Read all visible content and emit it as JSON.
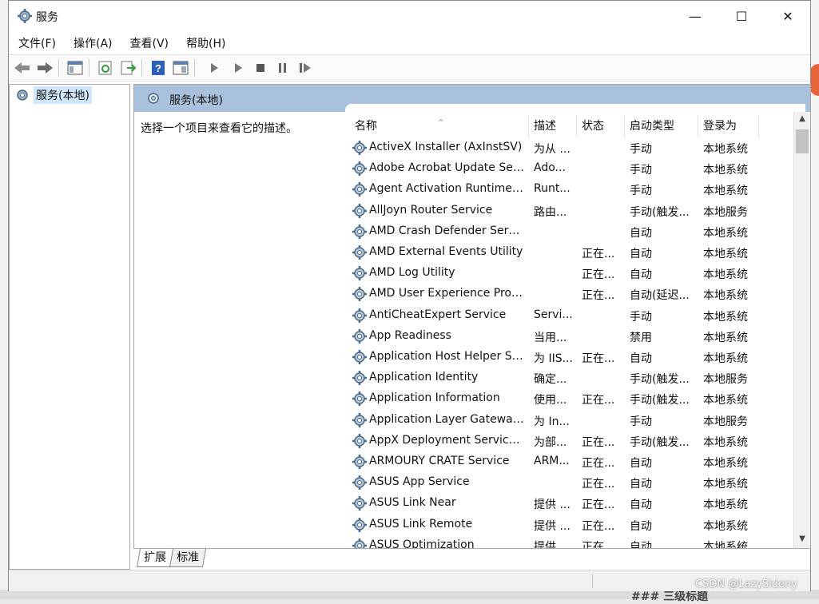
{
  "window": {
    "title": "服务",
    "controls": {
      "minimize": "—",
      "maximize": "☐",
      "close": "✕"
    }
  },
  "menu": [
    "文件(F)",
    "操作(A)",
    "查看(V)",
    "帮助(H)"
  ],
  "toolbar": {
    "icons": [
      "back-arrow-icon",
      "forward-arrow-icon",
      "show-hide-tree-icon",
      "refresh-icon",
      "export-list-icon",
      "help-icon",
      "properties-icon",
      "start-service-icon",
      "start-service-alt-icon",
      "stop-service-icon",
      "pause-service-icon",
      "restart-service-icon"
    ]
  },
  "tree": {
    "root_label": "服务(本地)"
  },
  "pane": {
    "header": "服务(本地)",
    "description": "选择一个项目来查看它的描述。"
  },
  "columns": [
    "名称",
    "描述",
    "状态",
    "启动类型",
    "登录为"
  ],
  "services": [
    {
      "name": "ActiveX Installer (AxInstSV)",
      "desc": "为从 ...",
      "status": "",
      "startup": "手动",
      "logon": "本地系统"
    },
    {
      "name": "Adobe Acrobat Update Ser...",
      "desc": "Ado...",
      "status": "",
      "startup": "手动",
      "logon": "本地系统"
    },
    {
      "name": "Agent Activation Runtime_...",
      "desc": "Runt...",
      "status": "",
      "startup": "手动",
      "logon": "本地系统"
    },
    {
      "name": "AllJoyn Router Service",
      "desc": "路由...",
      "status": "",
      "startup": "手动(触发...",
      "logon": "本地服务"
    },
    {
      "name": "AMD Crash Defender Servi...",
      "desc": "",
      "status": "",
      "startup": "自动",
      "logon": "本地系统"
    },
    {
      "name": "AMD External Events Utility",
      "desc": "",
      "status": "正在...",
      "startup": "自动",
      "logon": "本地系统"
    },
    {
      "name": "AMD Log Utility",
      "desc": "",
      "status": "正在...",
      "startup": "自动",
      "logon": "本地系统"
    },
    {
      "name": "AMD User Experience Prog...",
      "desc": "",
      "status": "正在...",
      "startup": "自动(延迟...",
      "logon": "本地系统"
    },
    {
      "name": "AntiCheatExpert Service",
      "desc": "Servi...",
      "status": "",
      "startup": "手动",
      "logon": "本地系统"
    },
    {
      "name": "App Readiness",
      "desc": "当用...",
      "status": "",
      "startup": "禁用",
      "logon": "本地系统"
    },
    {
      "name": "Application Host Helper Se...",
      "desc": "为 IIS...",
      "status": "正在...",
      "startup": "自动",
      "logon": "本地系统"
    },
    {
      "name": "Application Identity",
      "desc": "确定...",
      "status": "",
      "startup": "手动(触发...",
      "logon": "本地服务"
    },
    {
      "name": "Application Information",
      "desc": "使用...",
      "status": "正在...",
      "startup": "手动(触发...",
      "logon": "本地系统"
    },
    {
      "name": "Application Layer Gateway ...",
      "desc": "为 In...",
      "status": "",
      "startup": "手动",
      "logon": "本地服务"
    },
    {
      "name": "AppX Deployment Service ...",
      "desc": "为部...",
      "status": "正在...",
      "startup": "手动(触发...",
      "logon": "本地系统"
    },
    {
      "name": "ARMOURY CRATE Service",
      "desc": "ARM...",
      "status": "正在...",
      "startup": "自动",
      "logon": "本地系统"
    },
    {
      "name": "ASUS App Service",
      "desc": "",
      "status": "正在...",
      "startup": "自动",
      "logon": "本地系统"
    },
    {
      "name": "ASUS Link Near",
      "desc": "提供 ...",
      "status": "正在...",
      "startup": "自动",
      "logon": "本地系统"
    },
    {
      "name": "ASUS Link Remote",
      "desc": "提供 ...",
      "status": "正在...",
      "startup": "自动",
      "logon": "本地系统"
    },
    {
      "name": "ASUS Optimization",
      "desc": "提供...",
      "status": "正在...",
      "startup": "自动",
      "logon": "本地系统"
    }
  ],
  "tabs": [
    "扩展",
    "标准"
  ],
  "background": {
    "heading_fragment": "### 三级标题"
  },
  "watermark": "CSDN @LazySideny",
  "colors": {
    "pane_header": "#a9c1db",
    "selection": "#cfe6fb"
  }
}
